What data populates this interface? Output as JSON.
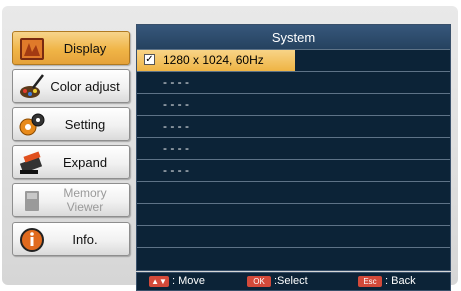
{
  "sidebar": {
    "items": [
      {
        "label": "Display",
        "state": "active",
        "icon": "display-icon"
      },
      {
        "label": "Color adjust",
        "state": "normal",
        "icon": "color-adjust-icon"
      },
      {
        "label": "Setting",
        "state": "normal",
        "icon": "gears-icon"
      },
      {
        "label": "Expand",
        "state": "normal",
        "icon": "expand-icon"
      },
      {
        "label": "Memory Viewer",
        "line1": "Memory",
        "line2": "Viewer",
        "state": "disabled",
        "icon": "memory-card-icon"
      },
      {
        "label": "Info.",
        "state": "normal",
        "icon": "info-icon"
      }
    ]
  },
  "panel": {
    "title": "System",
    "rows": [
      {
        "text": "1280 x 1024, 60Hz",
        "checked": true,
        "selected": true
      },
      {
        "text": "- - - -"
      },
      {
        "text": "- - - -"
      },
      {
        "text": "- - - -"
      },
      {
        "text": "- - - -"
      },
      {
        "text": "- - - -"
      },
      {
        "text": ""
      },
      {
        "text": ""
      },
      {
        "text": ""
      },
      {
        "text": ""
      }
    ]
  },
  "footer": {
    "move_key": "▲▼",
    "move_label": ": Move",
    "select_key": "OK",
    "select_label": ":Select",
    "back_key": "Esc",
    "back_label": ": Back"
  },
  "colors": {
    "accent": "#f0b547",
    "panel_bg": "#0c2337",
    "title_bg": "#2d4a6b",
    "key_bg": "#d44a3a"
  }
}
